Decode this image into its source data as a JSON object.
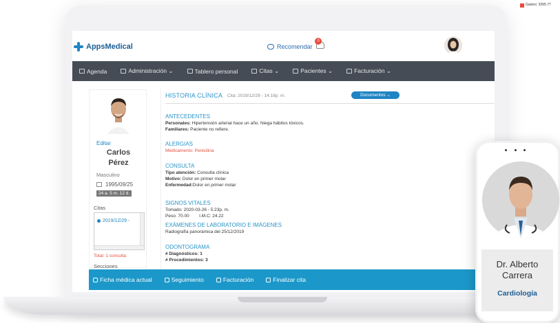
{
  "header": {
    "logo_text": "AppsMedical",
    "recommend_label": "Recomendar",
    "notification_count": "0"
  },
  "nav": {
    "items": [
      {
        "label": "Agenda"
      },
      {
        "label": "Administración ⌄"
      },
      {
        "label": "Tablero personal"
      },
      {
        "label": "Citas ⌄"
      },
      {
        "label": "Pacientes ⌄"
      },
      {
        "label": "Facturación ⌄"
      }
    ]
  },
  "patient": {
    "edit_label": "Editar",
    "first_name": "Carlos",
    "last_name": "Pérez",
    "gender": "Masculino",
    "dob": "1995/09/25",
    "age": "24 a. 5 m. 12 d.",
    "citas_label": "Citas",
    "cita_item": "2019/12/29 -",
    "total_consultas": "Total: 1 consulta",
    "secciones_label": "Secciones"
  },
  "history": {
    "title": "HISTORIA CLÍNICA",
    "date": "Cita: 2019/12/29 - 14:18p. m.",
    "documents_button": "Documentos ⌄",
    "antecedentes": {
      "head": "ANTECEDENTES",
      "l1_label": "Personales:",
      "l1_value": " Hipertensión arterial hace un año. Niega hábitos tóxicos.",
      "l2_label": "Familiares:",
      "l2_value": " Paciente no refiere."
    },
    "alergias": {
      "head": "ALERGIAS",
      "value": "Medicamento: Penicilina"
    },
    "consulta": {
      "head": "CONSULTA",
      "l1_label": "Tipo atención:",
      "l1_value": " Consulta clínica",
      "l2_label": "Motivo:",
      "l2_value": " Dolor en primer molar",
      "l3_label": "Enfermedad:",
      "l3_value": "Dolor en primer molar"
    },
    "signos": {
      "head": "SIGNOS VITALES",
      "l1": "Tomado: 2020-03-26 - 5:23p. m.",
      "l2": "Peso: 70.00        I.M.C: 24.22"
    },
    "examenes": {
      "head": "EXÁMENES DE LABORATORIO E IMÁGENES",
      "value": "Radiografía panorámica del 25/12/2019"
    },
    "odontograma": {
      "head": "ODONTOGRAMA",
      "l1": "# Diagnósticos: 1",
      "l2": "# Procedimientos: 3"
    }
  },
  "footer": {
    "items": [
      {
        "label": "Ficha médica actual"
      },
      {
        "label": "Seguimiento"
      },
      {
        "label": "Facturación"
      },
      {
        "label": "Finalizar cita"
      }
    ]
  },
  "doctor": {
    "name_line1": "Dr. Alberto",
    "name_line2": "Carrera",
    "specialty": "Cardiología"
  },
  "corner": {
    "text": "Gastos: 3395.77"
  },
  "colors": {
    "navbar": "#454c55",
    "accent": "#1f84c4",
    "footer": "#1b98c9",
    "alert": "#e74c3c"
  }
}
